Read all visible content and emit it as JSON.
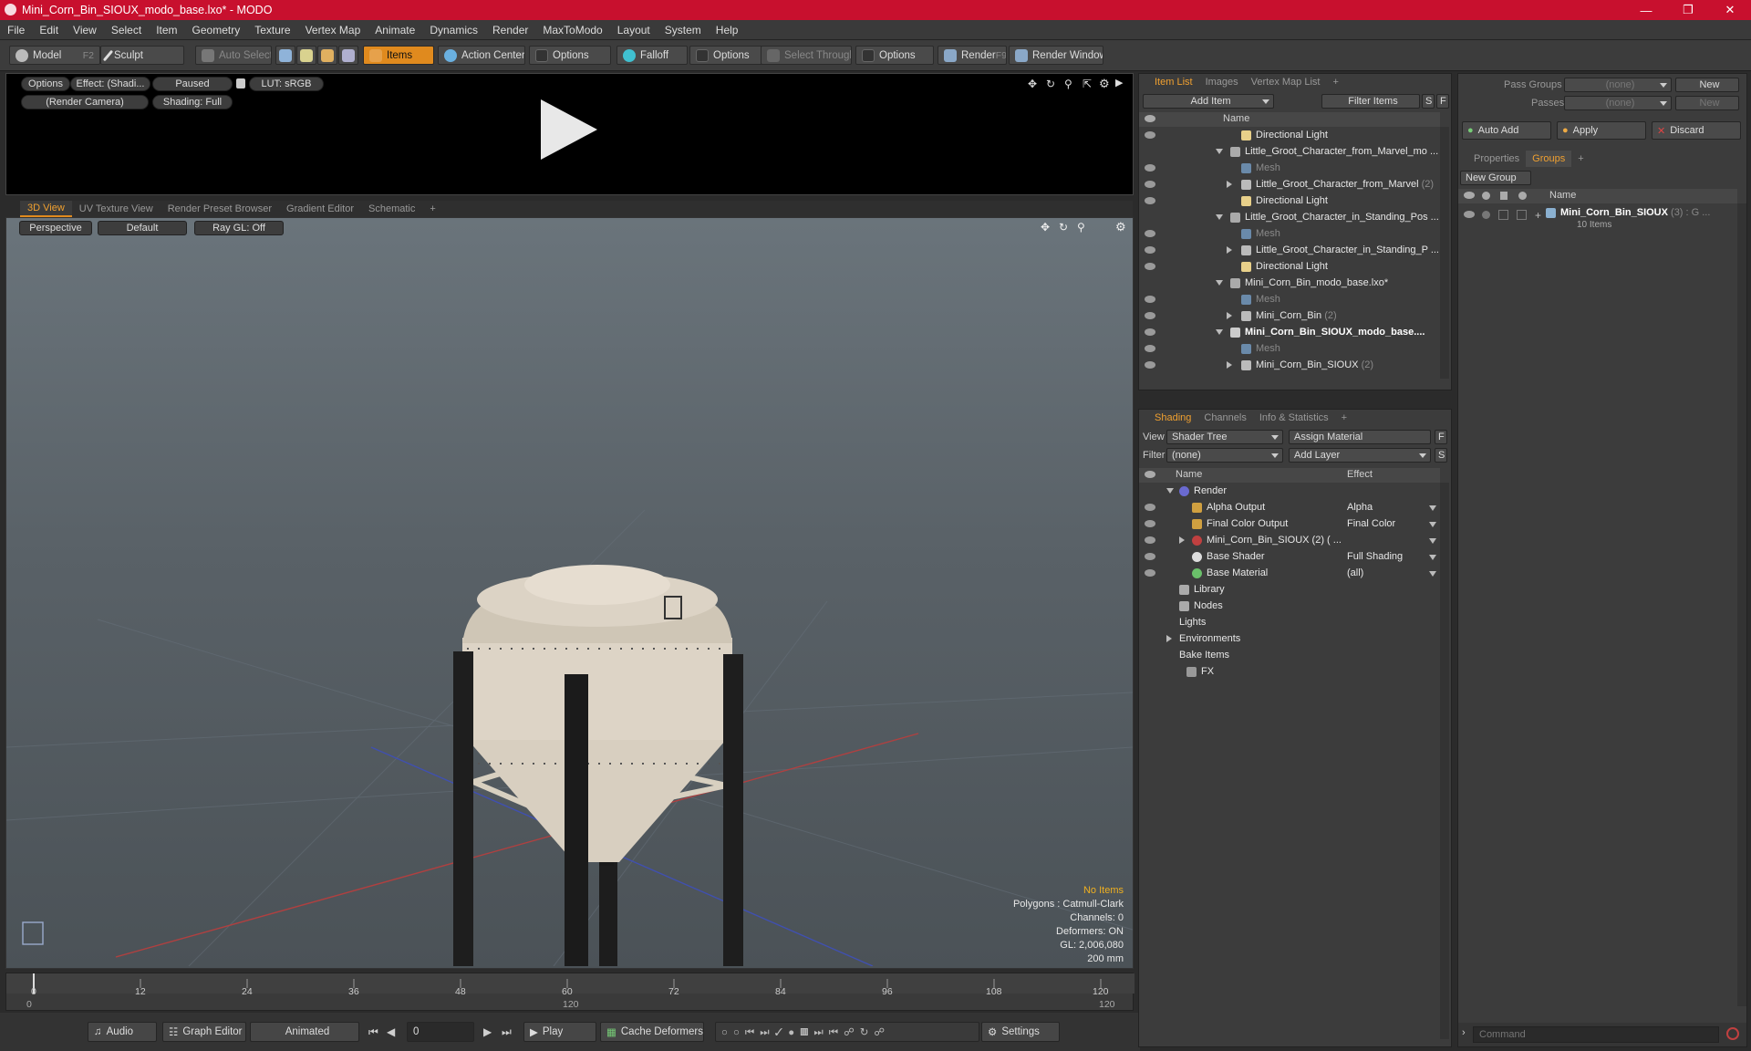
{
  "window": {
    "title": "Mini_Corn_Bin_SIOUX_modo_base.lxo* - MODO"
  },
  "menu": [
    "File",
    "Edit",
    "View",
    "Select",
    "Item",
    "Geometry",
    "Texture",
    "Vertex Map",
    "Animate",
    "Dynamics",
    "Render",
    "MaxToModo",
    "Layout",
    "System",
    "Help"
  ],
  "toolbar": {
    "model": "Model",
    "model_key": "F2",
    "sculpt": "Sculpt",
    "auto_select": "Auto Select",
    "items": "Items",
    "action_center": "Action Center",
    "options1": "Options",
    "falloff": "Falloff",
    "options2": "Options",
    "select_through": "Select Through",
    "options3": "Options",
    "render": "Render",
    "render_key": "F9",
    "render_window": "Render Window"
  },
  "preview": {
    "options": "Options",
    "effect": "Effect: (Shadi...",
    "paused": "Paused",
    "lut": "LUT: sRGB",
    "camera": "(Render Camera)",
    "shading": "Shading: Full"
  },
  "viewport_tabs": [
    "3D View",
    "UV Texture View",
    "Render Preset Browser",
    "Gradient Editor",
    "Schematic"
  ],
  "viewport": {
    "perspective": "Perspective",
    "default": "Default",
    "raygl": "Ray GL: Off",
    "info": {
      "no_items": "No Items",
      "polygons": "Polygons : Catmull-Clark",
      "channels": "Channels: 0",
      "deformers": "Deformers: ON",
      "gl": "GL: 2,006,080",
      "size": "200 mm"
    }
  },
  "timeline": {
    "ticks": [
      "0",
      "12",
      "24",
      "36",
      "48",
      "60",
      "72",
      "84",
      "96",
      "108",
      "120"
    ],
    "start": "0",
    "end": "120",
    "mid": "120"
  },
  "bottom": {
    "audio": "Audio",
    "graph_editor": "Graph Editor",
    "animated": "Animated",
    "frame": "0",
    "play": "Play",
    "cache": "Cache Deformers",
    "settings": "Settings"
  },
  "item_list": {
    "tabs": [
      "Item List",
      "Images",
      "Vertex Map List"
    ],
    "add_item": "Add Item",
    "filter": "Filter Items",
    "s": "S",
    "f": "F",
    "col_name": "Name",
    "rows": [
      {
        "text": "Directional Light",
        "count": ""
      },
      {
        "text": "Little_Groot_Character_from_Marvel_mo ...",
        "count": ""
      },
      {
        "text": "Mesh",
        "count": ""
      },
      {
        "text": "Little_Groot_Character_from_Marvel",
        "count": "(2)"
      },
      {
        "text": "Directional Light",
        "count": ""
      },
      {
        "text": "Little_Groot_Character_in_Standing_Pos ...",
        "count": ""
      },
      {
        "text": "Mesh",
        "count": ""
      },
      {
        "text": "Little_Groot_Character_in_Standing_P ...",
        "count": ""
      },
      {
        "text": "Directional Light",
        "count": ""
      },
      {
        "text": "Mini_Corn_Bin_modo_base.lxo*",
        "count": ""
      },
      {
        "text": "Mesh",
        "count": ""
      },
      {
        "text": "Mini_Corn_Bin",
        "count": "(2)"
      },
      {
        "text": "Mini_Corn_Bin_SIOUX_modo_base....",
        "count": ""
      },
      {
        "text": "Mesh",
        "count": ""
      },
      {
        "text": "Mini_Corn_Bin_SIOUX",
        "count": "(2)"
      }
    ]
  },
  "shading": {
    "tabs": [
      "Shading",
      "Channels",
      "Info & Statistics"
    ],
    "view_label": "View",
    "view_value": "Shader Tree",
    "assign": "Assign Material",
    "f": "F",
    "filter_label": "Filter",
    "filter_value": "(none)",
    "add_layer": "Add Layer",
    "s": "S",
    "col_name": "Name",
    "col_effect": "Effect",
    "rows": [
      {
        "text": "Render",
        "effect": ""
      },
      {
        "text": "Alpha Output",
        "effect": "Alpha"
      },
      {
        "text": "Final Color Output",
        "effect": "Final Color"
      },
      {
        "text": "Mini_Corn_Bin_SIOUX (2) ( ...",
        "effect": ""
      },
      {
        "text": "Base Shader",
        "effect": "Full Shading"
      },
      {
        "text": "Base Material",
        "effect": "(all)"
      },
      {
        "text": "Library",
        "effect": ""
      },
      {
        "text": "Nodes",
        "effect": ""
      },
      {
        "text": "Lights",
        "effect": ""
      },
      {
        "text": "Environments",
        "effect": ""
      },
      {
        "text": "Bake Items",
        "effect": ""
      },
      {
        "text": "FX",
        "effect": ""
      }
    ]
  },
  "groups_panel": {
    "pass_groups": "Pass Groups",
    "passes": "Passes",
    "none1": "(none)",
    "none2": "(none)",
    "new1": "New",
    "new2": "New",
    "auto_add": "Auto Add",
    "apply": "Apply",
    "discard": "Discard",
    "tabs": [
      "Properties",
      "Groups"
    ],
    "new_group": "New Group",
    "col_name": "Name",
    "group_name": "Mini_Corn_Bin_SIOUX",
    "group_count": "(3) : G ...",
    "group_items": "10 Items"
  },
  "command": {
    "placeholder": "Command"
  }
}
